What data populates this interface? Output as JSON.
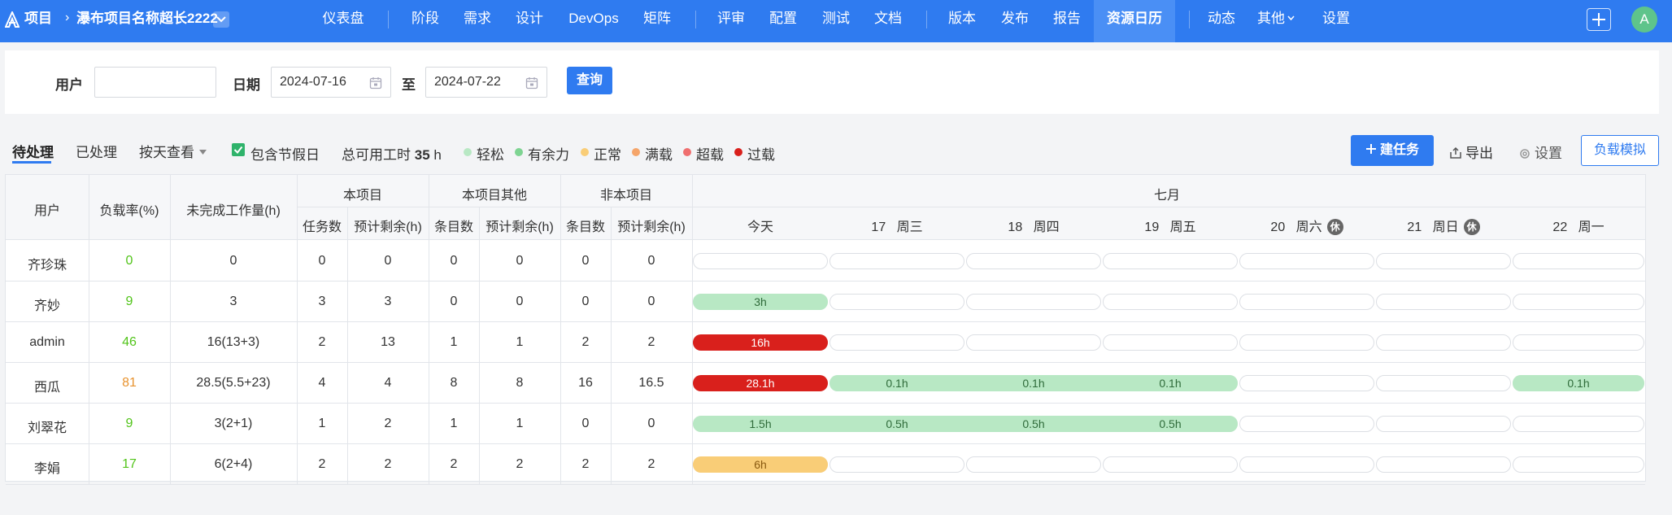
{
  "nav": {
    "project_label": "项目",
    "project_name": "瀑布项目名称超长2222",
    "items": [
      {
        "label": "仪表盘"
      },
      {
        "label": "阶段"
      },
      {
        "label": "需求"
      },
      {
        "label": "设计"
      },
      {
        "label": "DevOps"
      },
      {
        "label": "矩阵"
      },
      {
        "label": "评审"
      },
      {
        "label": "配置"
      },
      {
        "label": "测试"
      },
      {
        "label": "文档"
      },
      {
        "label": "版本"
      },
      {
        "label": "发布"
      },
      {
        "label": "报告"
      },
      {
        "label": "资源日历"
      },
      {
        "label": "动态"
      },
      {
        "label": "其他"
      },
      {
        "label": "设置"
      }
    ],
    "active": "资源日历",
    "avatar": "A"
  },
  "filter": {
    "user_label": "用户",
    "user_value": "",
    "date_label": "日期",
    "start_date": "2024-07-16",
    "to_label": "至",
    "end_date": "2024-07-22",
    "query_label": "查询"
  },
  "toolbar": {
    "tabs": [
      {
        "label": "待处理"
      },
      {
        "label": "已处理"
      }
    ],
    "view_by": "按天查看",
    "include_holiday": "包含节假日",
    "total_label": "总可用工时",
    "total_value": "35",
    "total_unit": "h",
    "legend": [
      {
        "label": "轻松",
        "color": "#b8e8c4"
      },
      {
        "label": "有余力",
        "color": "#7ed492"
      },
      {
        "label": "正常",
        "color": "#f9cd77"
      },
      {
        "label": "满载",
        "color": "#f5a56a"
      },
      {
        "label": "超载",
        "color": "#ef6f6f"
      },
      {
        "label": "过载",
        "color": "#d9201c"
      }
    ],
    "new_task": "建任务",
    "export": "导出",
    "settings": "设置",
    "simulate": "负载模拟"
  },
  "table": {
    "headers": {
      "user": "用户",
      "load_rate": "负载率(%)",
      "unfinished": "未完成工作量(h)",
      "this_project": "本项目",
      "this_project_other": "本项目其他",
      "non_project": "非本项目",
      "month": "七月",
      "task_count": "任务数",
      "est_remaining": "预计剩余(h)",
      "item_count": "条目数"
    },
    "days": [
      {
        "date": "",
        "weekday": "今天",
        "rest": ""
      },
      {
        "date": "17",
        "weekday": "周三",
        "rest": ""
      },
      {
        "date": "18",
        "weekday": "周四",
        "rest": ""
      },
      {
        "date": "19",
        "weekday": "周五",
        "rest": ""
      },
      {
        "date": "20",
        "weekday": "周六",
        "rest": "休"
      },
      {
        "date": "21",
        "weekday": "周日",
        "rest": "休"
      },
      {
        "date": "22",
        "weekday": "周一",
        "rest": ""
      }
    ],
    "rows": [
      {
        "user": "齐珍珠",
        "load": "0",
        "load_color": "#52c41a",
        "unfinished": "0",
        "c1": "0",
        "c2": "0",
        "c3": "0",
        "c4": "0",
        "c5": "0",
        "c6": "0",
        "bars": []
      },
      {
        "user": "齐妙",
        "load": "9",
        "load_color": "#52c41a",
        "unfinished": "3",
        "c1": "3",
        "c2": "3",
        "c3": "0",
        "c4": "0",
        "c5": "0",
        "c6": "0",
        "bars": [
          {
            "start": 0,
            "span": 1,
            "label": "3h",
            "color": "#b8e8c4",
            "text": "#2f6b3a"
          }
        ]
      },
      {
        "user": "admin",
        "load": "46",
        "load_color": "#52c41a",
        "unfinished": "16(13+3)",
        "c1": "2",
        "c2": "13",
        "c3": "1",
        "c4": "1",
        "c5": "2",
        "c6": "2",
        "bars": [
          {
            "start": 0,
            "span": 1,
            "label": "16h",
            "color": "#d9201c",
            "text": "#ffffff"
          }
        ]
      },
      {
        "user": "西瓜",
        "load": "81",
        "load_color": "#e8932f",
        "unfinished": "28.5(5.5+23)",
        "c1": "4",
        "c2": "4",
        "c3": "8",
        "c4": "8",
        "c5": "16",
        "c6": "16.5",
        "bars": [
          {
            "start": 0,
            "span": 1,
            "label": "28.1h",
            "color": "#d9201c",
            "text": "#ffffff"
          },
          {
            "start": 1,
            "span": 3,
            "labels": [
              "0.1h",
              "0.1h",
              "0.1h"
            ],
            "color": "#b8e8c4",
            "text": "#2f6b3a"
          },
          {
            "start": 6,
            "span": 1,
            "label": "0.1h",
            "color": "#b8e8c4",
            "text": "#2f6b3a"
          }
        ]
      },
      {
        "user": "刘翠花",
        "load": "9",
        "load_color": "#52c41a",
        "unfinished": "3(2+1)",
        "c1": "1",
        "c2": "2",
        "c3": "1",
        "c4": "1",
        "c5": "0",
        "c6": "0",
        "bars": [
          {
            "start": 0,
            "span": 4,
            "labels": [
              "1.5h",
              "0.5h",
              "0.5h",
              "0.5h"
            ],
            "color": "#b8e8c4",
            "text": "#2f6b3a"
          }
        ]
      },
      {
        "user": "李娟",
        "load": "17",
        "load_color": "#52c41a",
        "unfinished": "6(2+4)",
        "c1": "2",
        "c2": "2",
        "c3": "2",
        "c4": "2",
        "c5": "2",
        "c6": "2",
        "bars": [
          {
            "start": 0,
            "span": 1,
            "label": "6h",
            "color": "#f9cd77",
            "text": "#8a5a10"
          }
        ]
      }
    ]
  }
}
